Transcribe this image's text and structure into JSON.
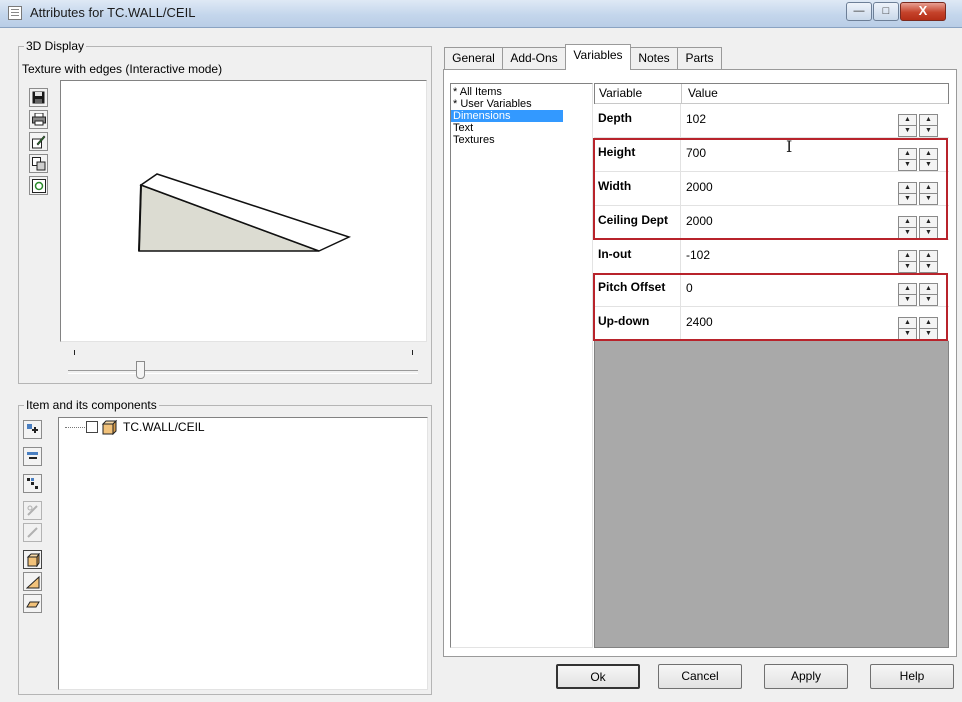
{
  "window": {
    "title": "Attributes for TC.WALL/CEIL",
    "minimize": "—",
    "maximize": "□",
    "close": "X"
  },
  "display3d": {
    "group_label": "3D Display",
    "mode_label": "Texture with edges (Interactive mode)"
  },
  "components": {
    "group_label": "Item and its components",
    "tree_item": "TC.WALL/CEIL"
  },
  "tabs": [
    {
      "label": "General"
    },
    {
      "label": "Add-Ons"
    },
    {
      "label": "Variables"
    },
    {
      "label": "Notes"
    },
    {
      "label": "Parts"
    }
  ],
  "active_tab": "Variables",
  "categories": [
    "* All Items",
    "* User Variables",
    "Dimensions",
    "Text",
    "Textures"
  ],
  "selected_category": "Dimensions",
  "grid": {
    "headers": {
      "variable": "Variable",
      "value": "Value"
    },
    "rows": [
      {
        "variable": "Depth",
        "value": "102"
      },
      {
        "variable": "Height",
        "value": "700"
      },
      {
        "variable": "Width",
        "value": "2000"
      },
      {
        "variable": "Ceiling Dept",
        "value": "2000"
      },
      {
        "variable": "In-out",
        "value": "-102"
      },
      {
        "variable": "Pitch Offset",
        "value": "0"
      },
      {
        "variable": "Up-down",
        "value": "2400"
      }
    ]
  },
  "buttons": {
    "ok": "Ok",
    "cancel": "Cancel",
    "apply": "Apply",
    "help": "Help"
  },
  "colors": {
    "highlight": "#b8232b",
    "selection": "#3399ff",
    "grid_empty": "#a9a9a9"
  }
}
